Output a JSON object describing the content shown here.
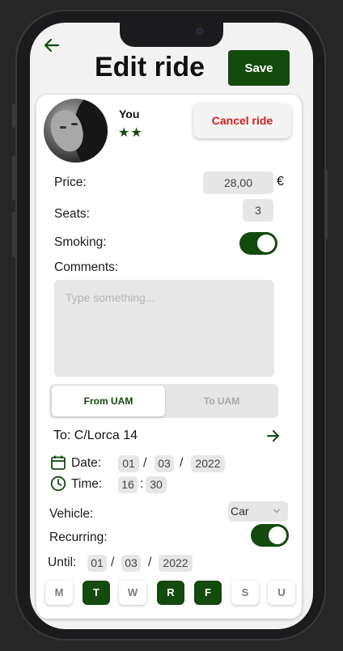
{
  "header": {
    "title": "Edit ride",
    "save_label": "Save"
  },
  "driver": {
    "name": "You",
    "stars": "★★",
    "cancel_label": "Cancel ride"
  },
  "form": {
    "price_label": "Price:",
    "price_value": "28,00",
    "currency": "€",
    "seats_label": "Seats:",
    "seats_value": "3",
    "smoking_label": "Smoking:",
    "smoking_enabled": true,
    "comments_label": "Comments:",
    "comments_placeholder": "Type something..."
  },
  "direction": {
    "options": [
      "From UAM",
      "To UAM"
    ],
    "selected": "From UAM"
  },
  "destination": {
    "text": "To: C/Lorca 14"
  },
  "date": {
    "label": "Date:",
    "day": "01",
    "month": "03",
    "year": "2022"
  },
  "time": {
    "label": "Time:",
    "hour": "16",
    "minute": "30"
  },
  "vehicle": {
    "label": "Vehicle:",
    "selected": "Car"
  },
  "recurring": {
    "label": "Recurring:",
    "enabled": true
  },
  "until": {
    "label": "Until:",
    "day": "01",
    "month": "03",
    "year": "2022"
  },
  "days": [
    {
      "label": "M",
      "selected": false
    },
    {
      "label": "T",
      "selected": true
    },
    {
      "label": "W",
      "selected": false
    },
    {
      "label": "R",
      "selected": true
    },
    {
      "label": "F",
      "selected": true
    },
    {
      "label": "S",
      "selected": false
    },
    {
      "label": "U",
      "selected": false
    }
  ],
  "colors": {
    "accent": "#134a0e",
    "danger": "#d0211a"
  }
}
